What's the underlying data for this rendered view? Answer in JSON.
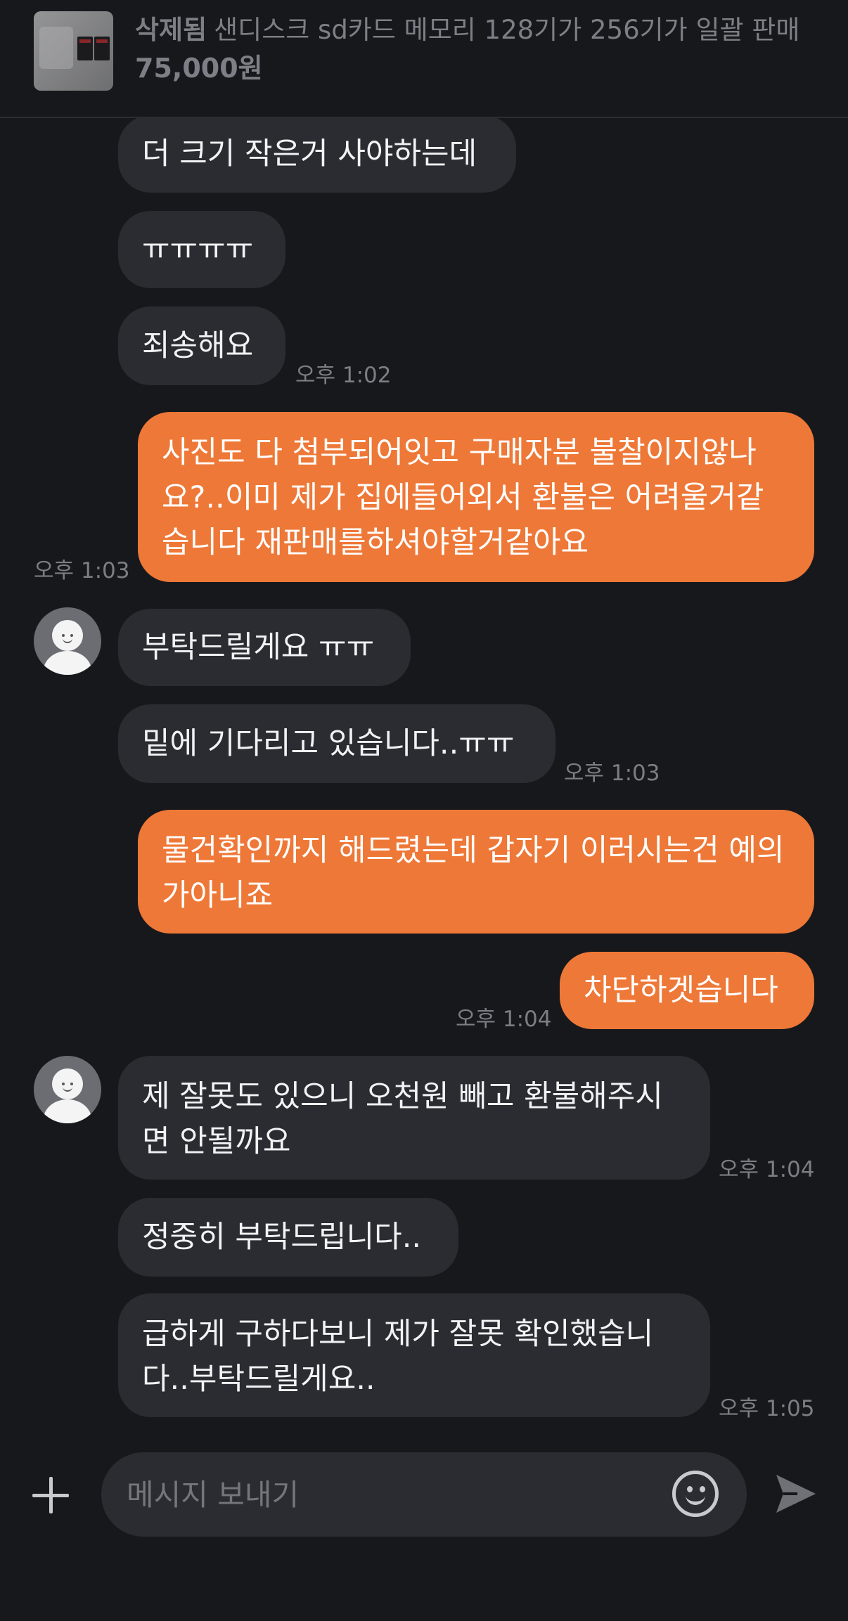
{
  "header": {
    "status": "삭제됨",
    "title": "샌디스크 sd카드 메모리 128기가 256기가 일괄 판매",
    "price": "75,000원"
  },
  "messages": [
    {
      "side": "in",
      "text": "더 크기 작은거 사야하는데"
    },
    {
      "side": "in",
      "text": "ㅠㅠㅠㅠ"
    },
    {
      "side": "in",
      "text": "죄송해요",
      "time": "오후 1:02"
    },
    {
      "side": "out",
      "text": "사진도 다 첨부되어잇고 구매자분 불찰이지않나요?..이미 제가 집에들어외서 환불은 어려울거같습니다 재판매를하셔야할거같아요",
      "time": "오후 1:03"
    },
    {
      "side": "in",
      "text": "부탁드릴게요 ㅠㅠ"
    },
    {
      "side": "in",
      "text": "밑에 기다리고 있습니다..ㅠㅠ",
      "time": "오후 1:03"
    },
    {
      "side": "out",
      "text": "물건확인까지 해드렸는데 갑자기 이러시는건 예의가아니죠"
    },
    {
      "side": "out",
      "text": "차단하겟습니다",
      "time": "오후 1:04"
    },
    {
      "side": "in",
      "text": "제 잘못도 있으니 오천원 빼고 환불해주시면 안될까요",
      "time": "오후 1:04"
    },
    {
      "side": "in",
      "text": "정중히 부탁드립니다.."
    },
    {
      "side": "in",
      "text": "급하게 구하다보니 제가 잘못 확인했습니다..부탁드릴게요..",
      "time": "오후 1:05"
    }
  ],
  "composer": {
    "placeholder": "메시지 보내기",
    "value": ""
  },
  "icons": {
    "attach": "plus-icon",
    "emoji": "emoji-icon",
    "send": "send-icon",
    "avatar": "default-profile-icon"
  },
  "colors": {
    "background": "#17181c",
    "incoming_bubble": "#2a2c31",
    "outgoing_bubble": "#ee7837"
  }
}
